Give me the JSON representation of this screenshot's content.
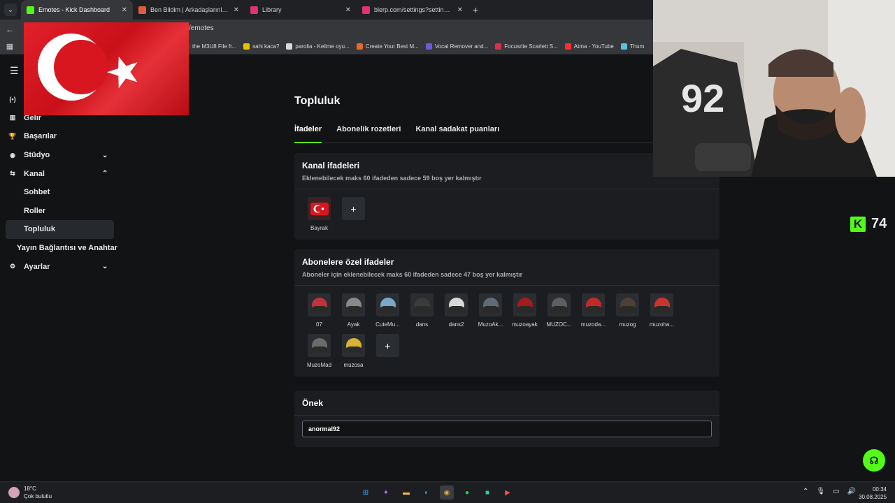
{
  "browser": {
    "tabs": [
      {
        "label": "Emotes - Kick Dashboard",
        "color": "#53fc18",
        "active": true
      },
      {
        "label": "Ben Bildim | Arkadaşlarınla Onli",
        "color": "#e35d3a",
        "active": false
      },
      {
        "label": "Library",
        "color": "#e0336e",
        "active": false
      },
      {
        "label": "blerp.com/settings?settingsTyp",
        "color": "#e0336e",
        "active": false
      }
    ],
    "url": "/emotes",
    "bookmarks": [
      {
        "label": "the M3U8 File fr...",
        "color": "#4a4d52"
      },
      {
        "label": "sahi kaca?",
        "color": "#e6c200"
      },
      {
        "label": "parolla - Kelime oyu...",
        "color": "#d9d9d9"
      },
      {
        "label": "Create Your Best M...",
        "color": "#e06b2d"
      },
      {
        "label": "Vocal Remover and...",
        "color": "#6a5cd6"
      },
      {
        "label": "Focusrite Scarlett S...",
        "color": "#d8324a"
      },
      {
        "label": "Atma - YouTube",
        "color": "#ff2d2d"
      },
      {
        "label": "Thum",
        "color": "#5bc0de"
      }
    ]
  },
  "sidebar": {
    "items": [
      {
        "icon": "(•)",
        "label": "",
        "chev": ""
      },
      {
        "icon": "▥",
        "label": "Gelir",
        "chev": ""
      },
      {
        "icon": "🏆",
        "label": "Başarılar",
        "chev": ""
      },
      {
        "icon": "◉",
        "label": "Stüdyo",
        "chev": "⌄"
      },
      {
        "icon": "⇆",
        "label": "Kanal",
        "chev": "⌃"
      }
    ],
    "sub_items": [
      "Sohbet",
      "Roller",
      "Topluluk"
    ],
    "active_sub": "Topluluk",
    "stream_key": "Yayın Bağlantısı ve Anahtar",
    "settings": {
      "icon": "⚙",
      "label": "Ayarlar",
      "chev": "⌄"
    }
  },
  "main": {
    "title": "Topluluk",
    "tabs": [
      "İfadeler",
      "Abonelik rozetleri",
      "Kanal sadakat puanları"
    ],
    "channel_emotes": {
      "title": "Kanal ifadeleri",
      "desc": "Eklenebilecek maks 60 ifadeden sadece 59 boş yer kalmıştır",
      "emotes": [
        "Bayrak"
      ]
    },
    "sub_emotes": {
      "title": "Abonelere özel ifadeler",
      "desc": "Aboneler için eklenebilecek maks 60 ifadeden sadece 47 boş yer kalmıştır",
      "emotes": [
        "07",
        "Ayak",
        "CuteMu...",
        "dans",
        "dans2",
        "MuzoAk...",
        "muzoayak",
        "MUZOC...",
        "muzoda...",
        "muzog",
        "muzoha...",
        "MuzoMad",
        "muzosa"
      ]
    },
    "prefix": {
      "title": "Önek",
      "value": "anormal92"
    }
  },
  "overlay": {
    "viewer_count": "74"
  },
  "taskbar": {
    "temp": "18°C",
    "weather": "Çok bulutlu",
    "time": "00:34",
    "date": "30.08.2025"
  }
}
